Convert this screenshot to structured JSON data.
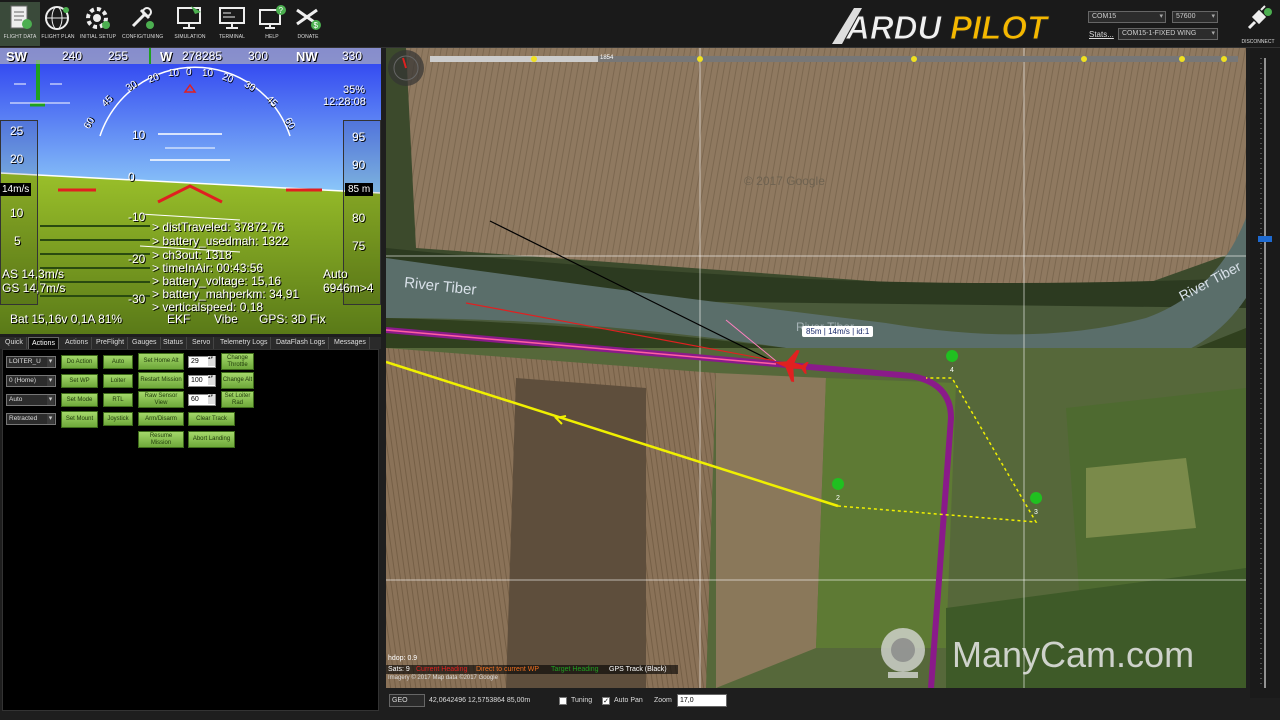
{
  "toolbar": {
    "buttons": [
      {
        "label": "FLIGHT DATA",
        "icon": "flight-data-icon"
      },
      {
        "label": "FLIGHT PLAN",
        "icon": "flight-plan-icon"
      },
      {
        "label": "INITIAL SETUP",
        "icon": "initial-setup-icon"
      },
      {
        "label": "CONFIG/TUNING",
        "icon": "config-tuning-icon"
      },
      {
        "label": "SIMULATION",
        "icon": "simulation-icon"
      },
      {
        "label": "TERMINAL",
        "icon": "terminal-icon"
      },
      {
        "label": "HELP",
        "icon": "help-icon"
      },
      {
        "label": "DONATE",
        "icon": "donate-icon"
      }
    ],
    "logo_text": "ARDUPILOT",
    "com_port": "COM15",
    "baud": "57600",
    "stats_label": "Stats...",
    "vehicle": "COM15-1-FIXED WING",
    "disconnect_label": "DISCONNECT"
  },
  "hud": {
    "heading_ticks": [
      "SW",
      "240",
      "255",
      "W",
      "278285",
      "300",
      "NW",
      "330"
    ],
    "battery_pct": "35%",
    "time": "12:28:08",
    "speed_ticks": [
      "25",
      "20",
      "10",
      "5"
    ],
    "alt_ticks": [
      "95",
      "90",
      "80",
      "75"
    ],
    "speed_readout": "14m/s",
    "alt_readout": "85 m",
    "pitch_labels": [
      "10",
      "0",
      "-10",
      "-20",
      "-30"
    ],
    "roll_labels": [
      "60",
      "45",
      "30",
      "20",
      "10",
      "0",
      "10",
      "20",
      "30",
      "45",
      "60"
    ],
    "telemetry": [
      "> distTraveled: 37872,76",
      "> battery_usedmah: 1322",
      "> ch3out: 1318",
      "> timeInAir: 00:43:56",
      "> battery_voltage: 15,16",
      "> battery_mahperkm: 34,91",
      "> verticalspeed: 0,18"
    ],
    "airspeed": "AS 14,3m/s",
    "groundspeed": "GS 14,7m/s",
    "mode": "Auto",
    "wp_dist": "6946m>4",
    "battery": "Bat 15,16v 0,1A 81%",
    "ekf": "EKF",
    "vibe": "Vibe",
    "gps": "GPS: 3D Fix"
  },
  "tabs": [
    "Quick",
    "Actions",
    "Actions",
    "PreFlight",
    "Gauges",
    "Status",
    "Servo",
    "Telemetry Logs",
    "DataFlash Logs",
    "Messages"
  ],
  "actions": {
    "selects": [
      "LOITER_U",
      "0 (Home)",
      "Auto",
      "Retracted"
    ],
    "buttons": [
      "Do Action",
      "Auto",
      "Set Home Alt",
      "Change Throttle",
      "Set WP",
      "Loiter",
      "Restart Mission",
      "Change Alt",
      "Set Mode",
      "RTL",
      "Raw Sensor View",
      "Set Loiter Rad",
      "Set Mount",
      "Joystick",
      "Arm/Disarm",
      "Clear Track",
      "Resume Mission",
      "Abort Landing"
    ],
    "numbers": [
      "29",
      "100",
      "60"
    ]
  },
  "map": {
    "timeline_value": "1854",
    "watermark": "© 2017 Google",
    "river_label_1": "River Tiber",
    "river_label_2": "River Tiber",
    "river_label_3": "River Tiber",
    "plane_tag": "85m | 14m/s | id:1",
    "hdop": "hdop: 0.9",
    "sats": "Sats: 9",
    "legend": [
      "Current Heading",
      "Direct to current WP",
      "Target Heading",
      "GPS Track (Black)"
    ],
    "attribution": "Imagery © 2017 Map data ©2017 Google",
    "manycam": "ManyCam.com",
    "waypoints": [
      "2",
      "3",
      "4"
    ],
    "colors": {
      "track": "#8a1a8a",
      "route": "#f0f000",
      "heading": "#e02020"
    }
  },
  "bottombar": {
    "proj": "GEO",
    "coords": "42,0642496  12,5753864    85,00m",
    "tuning_label": "Tuning",
    "autopan_label": "Auto Pan",
    "zoom_label": "Zoom",
    "zoom_value": "17,0"
  }
}
